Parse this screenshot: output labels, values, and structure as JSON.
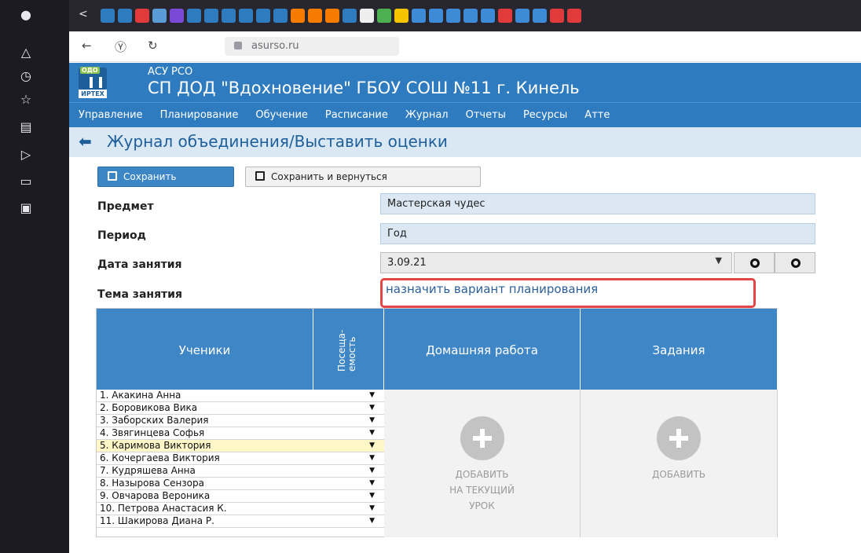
{
  "browser": {
    "url": "asurso.ru",
    "nav": {
      "back_icon": "arrow-left",
      "home_icon": "yandex",
      "reload_icon": "reload"
    },
    "favicons": [
      "#2f7bbf",
      "#2f7bbf",
      "#e03a3a",
      "#5b9bd5",
      "#7a4ad6",
      "#2f7bbf",
      "#2f7bbf",
      "#2f7bbf",
      "#2f7bbf",
      "#2f7bbf",
      "#2f7bbf",
      "#f57c00",
      "#f57c00",
      "#f57c00",
      "#2f7bbf",
      "#eeeeee",
      "#4caf50",
      "#f5c400",
      "#3d8bd6",
      "#3d8bd6",
      "#3d8bd6",
      "#3d8bd6",
      "#3d8bd6",
      "#e03a3a",
      "#3d8bd6",
      "#3d8bd6",
      "#e03a3a",
      "#e03a3a"
    ]
  },
  "app": {
    "subtitle": "АСУ РСО",
    "title": "СП ДОД \"Вдохновение\" ГБОУ СОШ №11 г. Кинель",
    "logo_top": "ОДО",
    "logo_bottom": "ИРТЕХ"
  },
  "menu": [
    "Управление",
    "Планирование",
    "Обучение",
    "Расписание",
    "Журнал",
    "Отчеты",
    "Ресурсы",
    "Атте"
  ],
  "page": {
    "title": "Журнал объединения/Выставить оценки"
  },
  "buttons": {
    "save": "Сохранить",
    "save_return": "Сохранить и вернуться"
  },
  "form": {
    "subject_label": "Предмет",
    "subject_value": "Мастерская чудес",
    "period_label": "Период",
    "period_value": "Год",
    "date_label": "Дата занятия",
    "date_value": "3.09.21",
    "theme_label": "Тема занятия",
    "theme_value": "назначить вариант планирования"
  },
  "table": {
    "col_students": "Ученики",
    "col_attendance": "Посеща-емость",
    "col_homework": "Домашняя работа",
    "col_tasks": "Задания",
    "students": [
      "1. Акакина Анна",
      "2. Боровикова Вика",
      "3. Заборских Валерия",
      "4. Звягинцева Софья",
      "5. Каримова Виктория",
      "6. Кочергаева Виктория",
      "7. Кудряшева Анна",
      "8. Назырова Сензора",
      "9. Овчарова Вероника",
      "10. Петрова Анастасия К.",
      "11. Шакирова Диана Р."
    ],
    "highlighted_index": 4,
    "homework_add": "ДОБАВИТЬ НА ТЕКУЩИЙ УРОК",
    "tasks_add": "ДОБАВИТЬ"
  }
}
